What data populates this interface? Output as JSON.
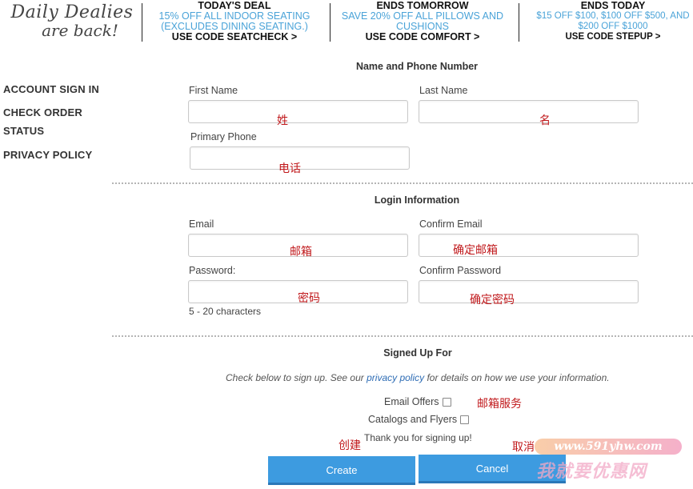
{
  "banner": {
    "logo": {
      "line1": "Daily Dealies",
      "line2": "are back!"
    },
    "deals": [
      {
        "heading": "TODAY'S DEAL",
        "body1": "15% OFF ALL INDOOR SEATING",
        "body2": "(EXCLUDES DINING SEATING.)",
        "code": "USE CODE SEATCHECK >"
      },
      {
        "heading": "ENDS TOMORROW",
        "body1": "SAVE 20% OFF ALL PILLOWS AND",
        "body2": "CUSHIONS",
        "code": "USE CODE COMFORT >"
      },
      {
        "heading": "ENDS TODAY",
        "body1": "$15 OFF $100, $100 OFF $500, AND",
        "body2": "$200 OFF $1000",
        "code": "USE CODE STEPUP >"
      }
    ]
  },
  "sidebar": {
    "items": [
      "ACCOUNT SIGN IN",
      "CHECK ORDER",
      "STATUS",
      "PRIVACY POLICY"
    ]
  },
  "form": {
    "section_name": "Name and Phone Number",
    "first_name_label": "First Name",
    "last_name_label": "Last Name",
    "phone_label": "Primary Phone",
    "section_login": "Login Information",
    "email_label": "Email",
    "confirm_email_label": "Confirm Email",
    "password_label": "Password:",
    "confirm_password_label": "Confirm Password",
    "password_hint": "5 - 20 characters",
    "section_signup": "Signed Up For",
    "signup_note_pre": "Check below to sign up. See our ",
    "signup_note_link": "privacy policy",
    "signup_note_post": " for details on how we use your information.",
    "email_offers_label": "Email Offers",
    "catalogs_label": "Catalogs and Flyers",
    "thank_you": "Thank you for signing up!",
    "create_button": "Create",
    "cancel_button": "Cancel"
  },
  "annotations": {
    "first_name": "姓",
    "last_name": "名",
    "phone": "电话",
    "email": "邮箱",
    "confirm_email": "确定邮箱",
    "password": "密码",
    "confirm_password": "确定密码",
    "email_service": "邮箱服务",
    "create": "创建",
    "cancel": "取消"
  },
  "watermark": {
    "url": "www.591yhw.com",
    "name": "我就要优惠网"
  },
  "colors": {
    "banner_blue": "#4aa3d8",
    "button_blue": "#3d9be0",
    "annotation_red": "#c0181b",
    "link_blue": "#2f6db5"
  }
}
